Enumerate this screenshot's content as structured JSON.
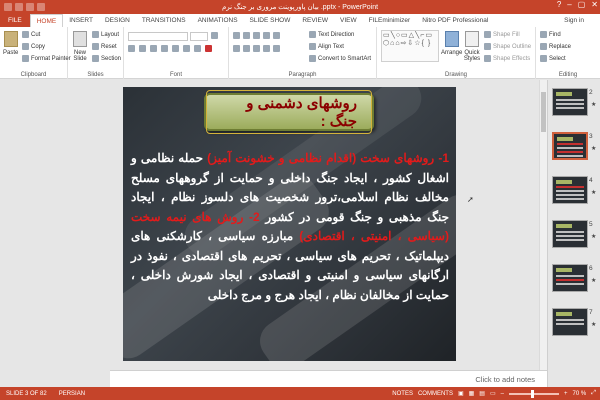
{
  "window": {
    "title": "بیان پاورپوینت مروری بر جنگ نرم .pptx - PowerPoint",
    "minimize": "–",
    "restore": "▢",
    "close": "✕",
    "help": "?"
  },
  "tabs": [
    {
      "label": "FILE"
    },
    {
      "label": "HOME"
    },
    {
      "label": "INSERT"
    },
    {
      "label": "DESIGN"
    },
    {
      "label": "TRANSITIONS"
    },
    {
      "label": "ANIMATIONS"
    },
    {
      "label": "SLIDE SHOW"
    },
    {
      "label": "REVIEW"
    },
    {
      "label": "VIEW"
    },
    {
      "label": "FILEminimizer"
    },
    {
      "label": "Nitro PDF Professional"
    }
  ],
  "signin": "Sign in",
  "ribbon": {
    "clipboard": {
      "label": "Clipboard",
      "paste": "Paste",
      "cut": "Cut",
      "copy": "Copy",
      "format_painter": "Format Painter"
    },
    "slides": {
      "label": "Slides",
      "new_slide": "New Slide",
      "layout": "Layout",
      "reset": "Reset",
      "section": "Section"
    },
    "font": {
      "label": "Font"
    },
    "paragraph": {
      "label": "Paragraph",
      "text_direction": "Text Direction",
      "align_text": "Align Text",
      "convert_smartart": "Convert to SmartArt"
    },
    "drawing": {
      "label": "Drawing",
      "arrange": "Arrange",
      "quick_styles": "Quick Styles",
      "shape_fill": "Shape Fill",
      "shape_outline": "Shape Outline",
      "shape_effects": "Shape Effects"
    },
    "editing": {
      "label": "Editing",
      "find": "Find",
      "replace": "Replace",
      "select": "Select"
    }
  },
  "slide": {
    "title": "روشهای دشمنی و جنگ :",
    "heading1": "1- روشهای سخت (اقدام نظامی و خشونت آمیز)",
    "para1": "حمله نظامی و اشغال کشور ، ایجاد جنگ داخلی و حمایت از گروههای مسلح مخالف نظام اسلامی،ترور شخصیت های دلسوز نظام ، ایجاد جنگ مذهبی و جنگ قومی در کشور",
    "heading2": "2- روش های نیمه سخت (سیاسی ، امنیتی ، اقتصادی)",
    "para2": "مبارزه سیاسی ، کارشکنی های دیپلماتیک ، تحریم های سیاسی ، تحریم های اقتصادی ، نفوذ در ارگانهای سیاسی و امنیتی و اقتصادی ، ایجاد شورش داخلی ، حمایت از مخالفان نظام ، ایجاد هرج و مرج داخلی"
  },
  "thumbnails": [
    {
      "num": "2",
      "star": "★"
    },
    {
      "num": "3",
      "star": "★"
    },
    {
      "num": "4",
      "star": "★"
    },
    {
      "num": "5",
      "star": "★"
    },
    {
      "num": "6",
      "star": "★"
    },
    {
      "num": "7",
      "star": "★"
    }
  ],
  "notes_placeholder": "Click to add notes",
  "status": {
    "slide": "SLIDE 3 OF 82",
    "language": "PERSIAN",
    "notes": "NOTES",
    "comments": "COMMENTS",
    "zoom": "70 %"
  }
}
